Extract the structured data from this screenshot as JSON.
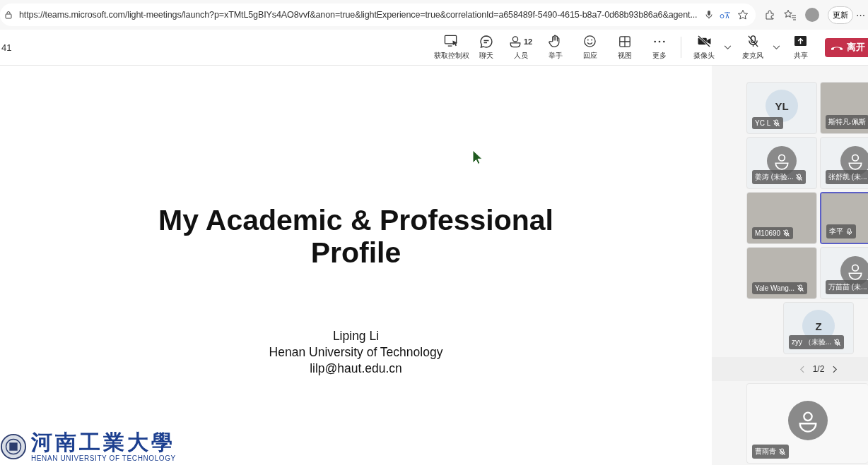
{
  "browser": {
    "url": "https://teams.microsoft.com/light-meetings/launch?p=xTMtL5gBIYs4AO8vvf&anon=true&lightExperience=true&correlationId=a658489f-5490-4615-b8a7-0d68b93b86a6&agent...",
    "update_button": "更新",
    "more": "⋯"
  },
  "meeting": {
    "timer": "41",
    "toolbar": [
      {
        "kind": "control",
        "label": "获取控制权"
      },
      {
        "kind": "chat",
        "label": "聊天"
      },
      {
        "kind": "people",
        "label": "人员",
        "count": "12"
      },
      {
        "kind": "hand",
        "label": "举手"
      },
      {
        "kind": "react",
        "label": "回应"
      },
      {
        "kind": "view",
        "label": "视图"
      },
      {
        "kind": "more",
        "label": "更多"
      }
    ],
    "devices": [
      {
        "kind": "camera",
        "label": "摄像头",
        "on": false
      },
      {
        "kind": "mic",
        "label": "麦克风",
        "on": false
      }
    ],
    "share": {
      "label": "共享"
    },
    "leave": {
      "label": "离开"
    }
  },
  "slide": {
    "title": "My Academic & Professional Profile",
    "author": "Liping Li",
    "affiliation": "Henan University of Technology",
    "email": "lilp@haut.edu.cn",
    "logo_cn": "河南工業大學",
    "logo_en": "HENAN UNIVERSITY OF TECHNOLOGY"
  },
  "participants": [
    {
      "kind": "initials",
      "initials": "YL",
      "name": "YC L",
      "muted": true,
      "speaking": false
    },
    {
      "kind": "video",
      "name": "斯特凡.佩斯",
      "speaking": false
    },
    {
      "kind": "avatar",
      "name": "姜涛 (未验...",
      "muted": true,
      "speaking": false
    },
    {
      "kind": "avatar",
      "name": "张舒凯 (未...",
      "speaking": false
    },
    {
      "kind": "video",
      "name": "M10690",
      "muted": true,
      "speaking": false
    },
    {
      "kind": "video",
      "name": "李平",
      "muted": false,
      "speaking": true
    },
    {
      "kind": "video",
      "name": "Yale Wang...",
      "muted": true,
      "speaking": false
    },
    {
      "kind": "avatar",
      "name": "万苗苗 (未...",
      "speaking": false
    },
    {
      "kind": "initials",
      "initials": "Z",
      "name": "zyy （未验...",
      "muted": true,
      "speaking": false
    }
  ],
  "pager": {
    "label": "1/2"
  },
  "featured": {
    "kind": "avatar",
    "name": "曹雨青",
    "muted": true,
    "speaking": false
  }
}
